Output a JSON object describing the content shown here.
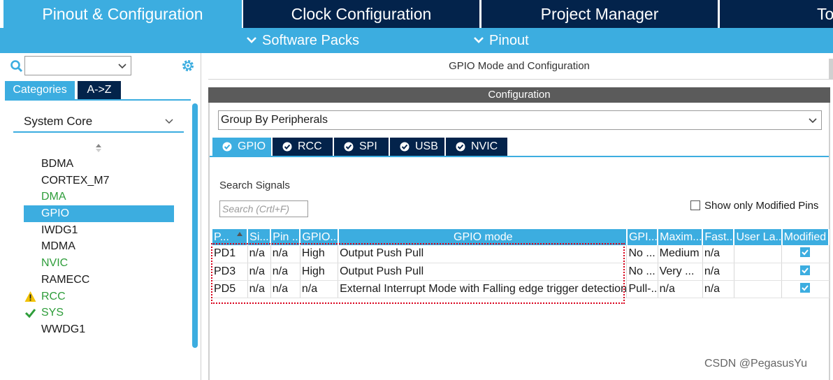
{
  "top_tabs": {
    "pinout": "Pinout & Configuration",
    "clock": "Clock Configuration",
    "project": "Project Manager",
    "tools": "Tools"
  },
  "sub_menu": {
    "software_packs": "Software Packs",
    "pinout": "Pinout"
  },
  "left": {
    "search_select_value": "",
    "category_tabs": {
      "categories": "Categories",
      "az": "A->Z"
    },
    "group_title": "System Core",
    "items": [
      {
        "label": "BDMA",
        "status": "none"
      },
      {
        "label": "CORTEX_M7",
        "status": "none"
      },
      {
        "label": "DMA",
        "status": "configured"
      },
      {
        "label": "GPIO",
        "status": "selected"
      },
      {
        "label": "IWDG1",
        "status": "none"
      },
      {
        "label": "MDMA",
        "status": "none"
      },
      {
        "label": "NVIC",
        "status": "configured"
      },
      {
        "label": "RAMECC",
        "status": "none"
      },
      {
        "label": "RCC",
        "status": "warning"
      },
      {
        "label": "SYS",
        "status": "ok"
      },
      {
        "label": "WWDG1",
        "status": "none"
      }
    ]
  },
  "main": {
    "mode_title": "GPIO Mode and Configuration",
    "config_title": "Configuration",
    "group_by": "Group By Peripherals",
    "peripheral_tabs": [
      "GPIO",
      "RCC",
      "SPI",
      "USB",
      "NVIC"
    ],
    "search_label": "Search Signals",
    "search_placeholder": "Search (Crtl+F)",
    "show_modified_label": "Show only Modified Pins",
    "table": {
      "headers": [
        "P...",
        "Si...",
        "Pin ...",
        "GPIO...",
        "GPIO mode",
        "GPI...",
        "Maxim...",
        "Fast...",
        "User La...",
        "Modified"
      ],
      "rows": [
        [
          "PD1",
          "n/a",
          "n/a",
          "High",
          "Output Push Pull",
          "No ...",
          "Medium",
          "n/a",
          "",
          true
        ],
        [
          "PD3",
          "n/a",
          "n/a",
          "High",
          "Output Push Pull",
          "No ...",
          "Very ...",
          "n/a",
          "",
          true
        ],
        [
          "PD5",
          "n/a",
          "n/a",
          "n/a",
          "External Interrupt Mode with Falling edge trigger detection",
          "Pull-...",
          "n/a",
          "n/a",
          "",
          true
        ]
      ]
    }
  },
  "watermark": "CSDN @PegasusYu",
  "colors": {
    "accent": "#3cade0",
    "navy": "#03234b",
    "config_bar": "#5b5b5b",
    "ok_green": "#2e9d3a",
    "warning_yellow": "#f2c200",
    "highlight_red": "#d9001b"
  }
}
